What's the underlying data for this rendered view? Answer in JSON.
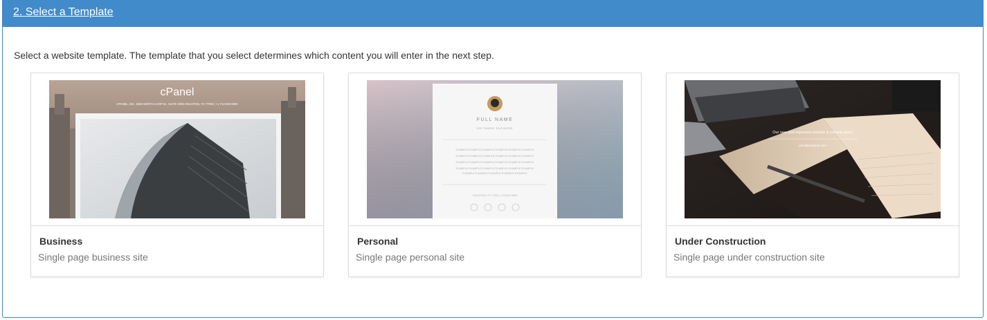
{
  "panel": {
    "title": "2. Select a Template",
    "intro": "Select a website template. The template that you select determines which content you will enter in the next step."
  },
  "templates": [
    {
      "name": "Business",
      "description": "Single page business site",
      "thumb_brand": "cPanel",
      "thumb_address": "CPANEL, INC. 2550 NORTH LOOP W., SUITE 4006 HOUSTON, TX 77092 | +1 713-529-0800"
    },
    {
      "name": "Personal",
      "description": "Single page personal site",
      "thumb_name": "FULL NAME",
      "thumb_role": "SOFTWARE ENGINEER",
      "thumb_body": "EXAMPLE EXAMPLE EXAMPLE EXAMPLE EXAMPLE EXAMPLE",
      "thumb_location": "HOUSTON, TX 77092 | 713-529-0800"
    },
    {
      "name": "Under Construction",
      "description": "Single page under construction site",
      "thumb_message": "Our new and improved website is coming soon!",
      "thumb_email": "user@example.com"
    }
  ]
}
